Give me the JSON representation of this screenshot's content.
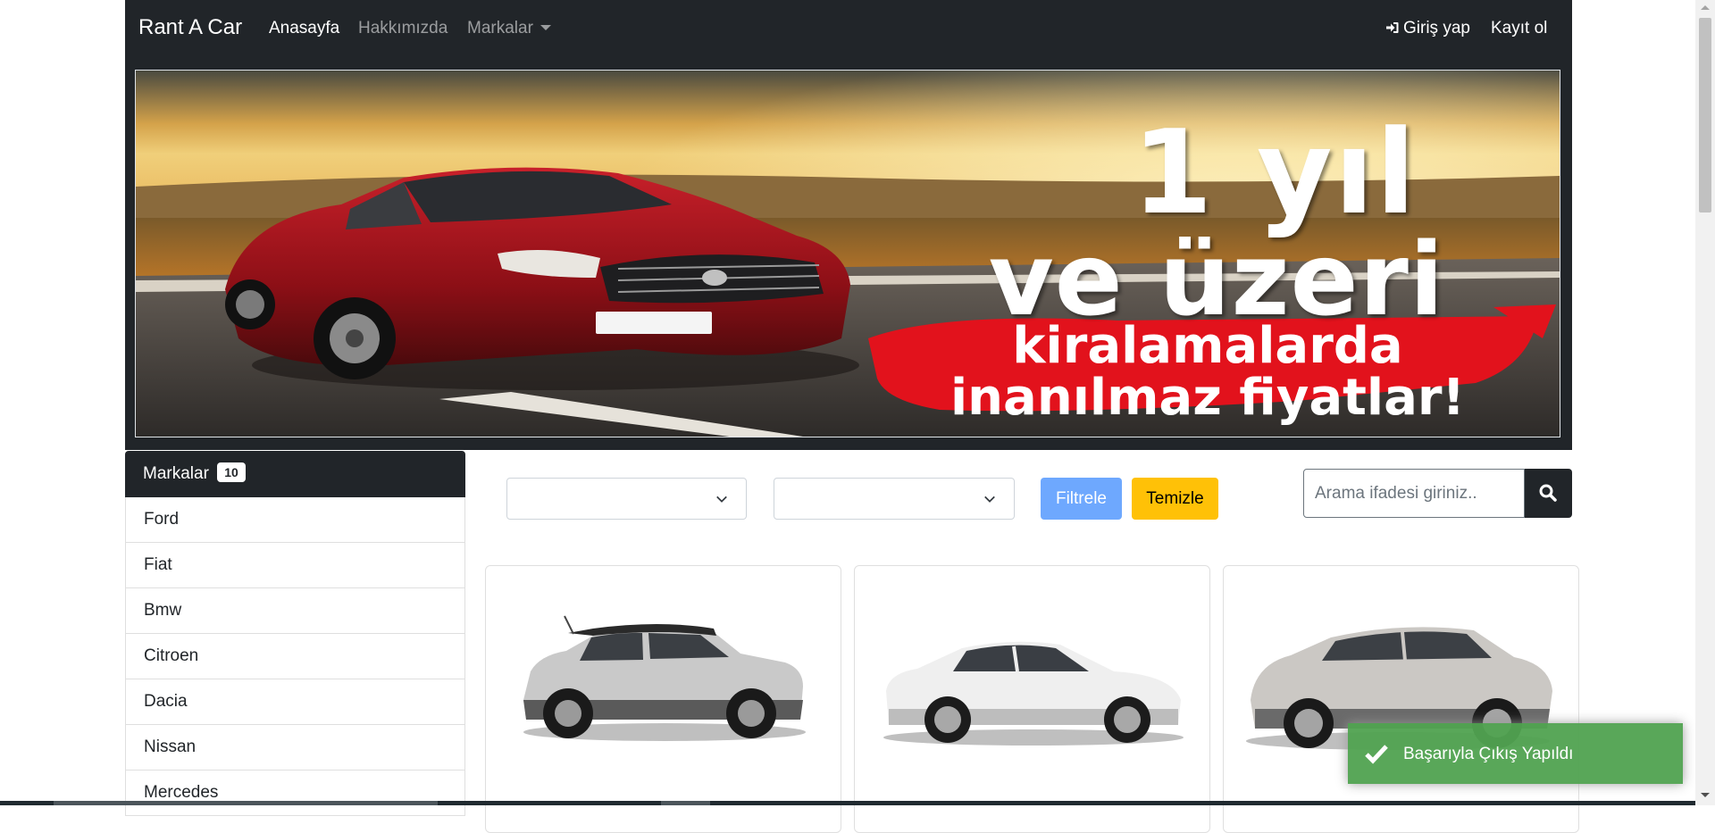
{
  "navbar": {
    "brand": "Rant A Car",
    "links": [
      {
        "label": "Anasayfa",
        "active": true
      },
      {
        "label": "Hakkımızda",
        "active": false
      },
      {
        "label": "Markalar",
        "active": false
      }
    ],
    "login_label": "Giriş yap",
    "register_label": "Kayıt ol",
    "login_icon": "sign-in-icon"
  },
  "banner": {
    "line1": "1 yıl",
    "line2": "ve üzeri",
    "line3": "kiralamalarda",
    "line4": "inanılmaz fiyatlar!"
  },
  "sidebar": {
    "header": "Markalar",
    "count": "10",
    "items": [
      "Ford",
      "Fiat",
      "Bmw",
      "Citroen",
      "Dacia",
      "Nissan",
      "Mercedes"
    ]
  },
  "filters": {
    "brand_select": "",
    "color_select": "",
    "filter_label": "Filtrele",
    "clear_label": "Temizle",
    "search_placeholder": "Arama ifadesi giriniz..",
    "search_icon": "search-icon"
  },
  "cars": [
    {
      "image": "white-suv-image"
    },
    {
      "image": "white-sedan-image"
    },
    {
      "image": "silver-crossover-image"
    }
  ],
  "toast": {
    "message": "Başarıyla Çıkış Yapıldı",
    "icon": "check-icon",
    "color": "#51a351"
  },
  "colors": {
    "navbar": "#212529",
    "filter_button": "#6ea8fe",
    "clear_button": "#ffc107"
  }
}
